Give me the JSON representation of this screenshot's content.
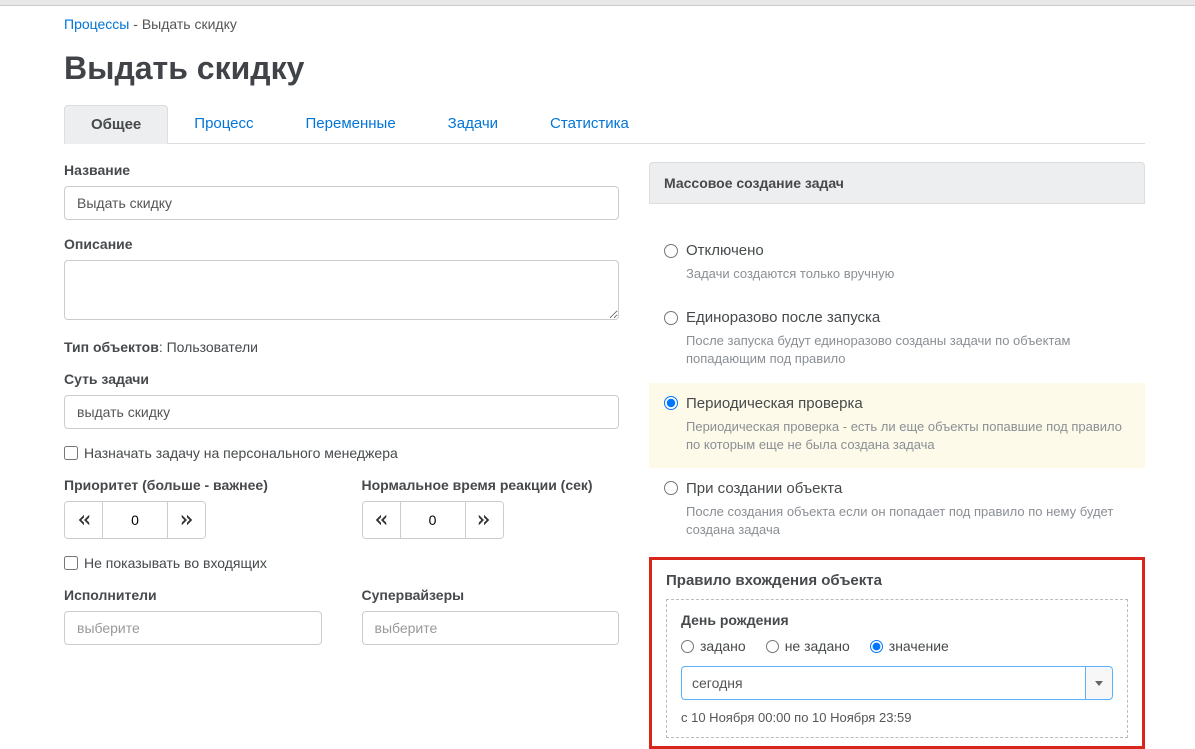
{
  "breadcrumb": {
    "link": "Процессы",
    "current": "Выдать скидку"
  },
  "page_title": "Выдать скидку",
  "tabs": [
    "Общее",
    "Процесс",
    "Переменные",
    "Задачи",
    "Статистика"
  ],
  "form": {
    "name_label": "Название",
    "name_value": "Выдать скидку",
    "desc_label": "Описание",
    "desc_value": "",
    "obj_type_label": "Тип объектов",
    "obj_type_value": "Пользователи",
    "essence_label": "Суть задачи",
    "essence_value": "выдать скидку",
    "assign_personal": "Назначать задачу на персонального менеджера",
    "priority_label": "Приоритет (больше - важнее)",
    "priority_value": "0",
    "reaction_label": "Нормальное время реакции (сек)",
    "reaction_value": "0",
    "hide_inbox": "Не показывать во входящих",
    "executors_label": "Исполнители",
    "executors_placeholder": "выберите",
    "supervisors_label": "Супервайзеры",
    "supervisors_placeholder": "выберите"
  },
  "mass": {
    "title": "Массовое создание задач",
    "options": [
      {
        "label": "Отключено",
        "desc": "Задачи создаются только вручную"
      },
      {
        "label": "Единоразово после запуска",
        "desc": "После запуска будут единоразово созданы задачи по объектам попадающим под правило"
      },
      {
        "label": "Периодическая проверка",
        "desc": "Периодическая проверка - есть ли еще объекты попавшие под правило по которым еще не была создана задача"
      },
      {
        "label": "При создании объекта",
        "desc": "После создания объекта если он попадает под правило по нему будет создана задача"
      }
    ]
  },
  "rule": {
    "panel_title": "Правило вхождения объекта",
    "field_title": "День рождения",
    "radios": {
      "set": "задано",
      "notset": "не задано",
      "value": "значение"
    },
    "select_value": "сегодня",
    "range": "с 10 Ноября 00:00 по 10 Ноября 23:59"
  }
}
